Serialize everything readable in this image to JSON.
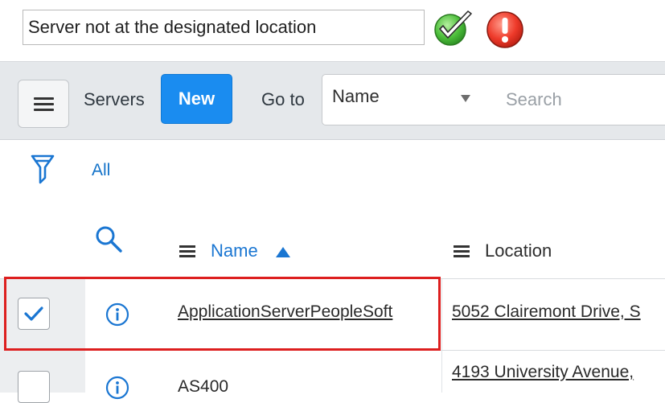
{
  "annotation": {
    "note_text": "Server not at the designated location",
    "confirm_icon": "green-check-icon",
    "error_icon": "red-exclamation-icon"
  },
  "toolbar": {
    "menu_icon": "hamburger-menu-icon",
    "list_title": "Servers",
    "new_label": "New",
    "goto_label": "Go to",
    "field_select_value": "Name",
    "search_placeholder": "Search",
    "accent_color": "#1a8cf0"
  },
  "filter": {
    "icon": "funnel-icon",
    "breadcrumb": "All"
  },
  "table": {
    "columns": [
      {
        "label": "Name",
        "sorted": "ascending"
      },
      {
        "label": "Location"
      }
    ],
    "rows": [
      {
        "selected": true,
        "name": "ApplicationServerPeopleSoft",
        "location": "5052 Clairemont Drive, S"
      },
      {
        "selected": false,
        "name": "AS400",
        "location": "4193 University Avenue,"
      }
    ],
    "highlight_color": "#dd1f1f"
  }
}
